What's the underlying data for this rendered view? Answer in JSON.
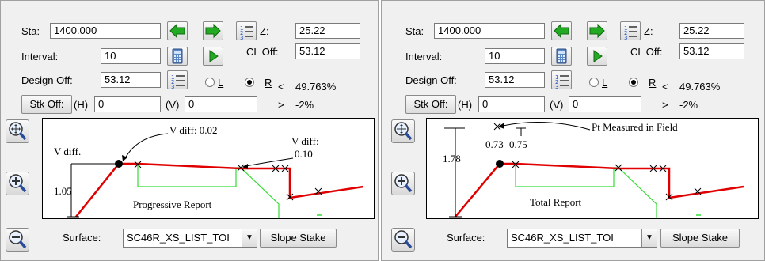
{
  "labels": {
    "sta": "Sta:",
    "interval": "Interval:",
    "design_off": "Design Off:",
    "stk_off": "Stk Off:",
    "h": "(H)",
    "v": "(V)",
    "z": "Z:",
    "cl_off": "CL Off:",
    "radio_l": "L",
    "radio_r": "R",
    "lt": "<",
    "gt": ">",
    "surface": "Surface:",
    "slope_stake": "Slope Stake"
  },
  "values": {
    "sta": "1400.000",
    "interval": "10",
    "design_off": "53.12",
    "stk_off_h": "0",
    "stk_off_v": "0",
    "z": "25.22",
    "cl_off": "53.12",
    "slope_pct": "49.763%",
    "grade_pct": "-2%",
    "surface": "SC46R_XS_LIST_TOI"
  },
  "side": "R",
  "left_plot": {
    "vdiff_label": "V diff.",
    "vdiff_002": "V diff: 0.02",
    "vdiff_010_a": "V diff:",
    "vdiff_010_b": "0.10",
    "dim_105": "1.05",
    "report": "Progressive Report"
  },
  "right_plot": {
    "pt_measured": "Pt Measured in Field",
    "dim_073": "0.73",
    "dim_075": "0.75",
    "dim_178": "1.78",
    "report": "Total Report"
  },
  "icons": [
    "arrow-left-icon",
    "arrow-right-icon",
    "list-icon",
    "calculator-icon",
    "play-icon",
    "zoom-extents-icon",
    "zoom-in-icon",
    "zoom-out-icon"
  ],
  "colors": {
    "design_line": "#e00000",
    "ground_line": "#00cc00",
    "arrow_green": "#22aa22"
  }
}
